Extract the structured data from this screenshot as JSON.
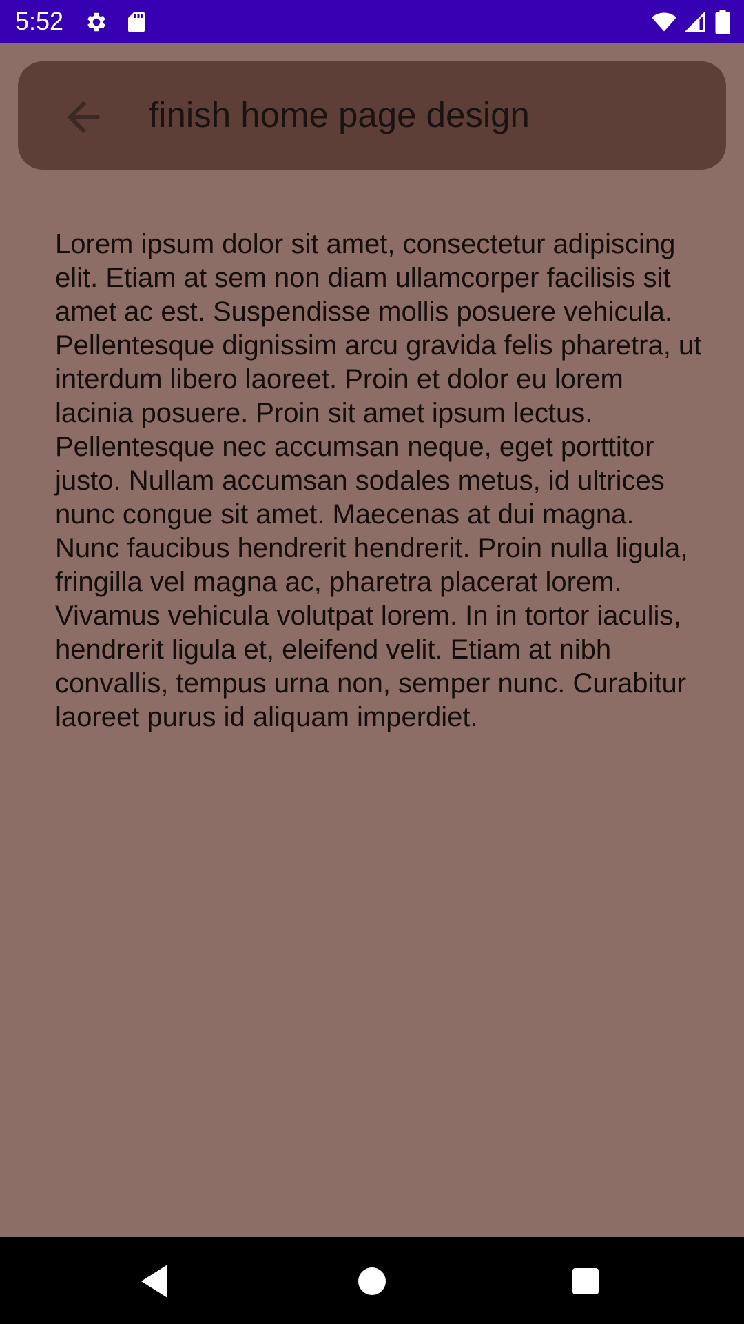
{
  "status_bar": {
    "time": "5:52",
    "icons": [
      "gear-icon",
      "sd-card-icon",
      "wifi-icon",
      "signal-icon",
      "battery-icon"
    ],
    "background": "#3700b3"
  },
  "app_bar": {
    "title": "finish home page design",
    "back_icon": "arrow-back-icon",
    "background": "#5d3f38"
  },
  "note": {
    "body": "Lorem ipsum dolor sit amet, consectetur adipiscing elit. Etiam at sem non diam ullamcorper facilisis sit amet ac est. Suspendisse mollis posuere vehicula. Pellentesque dignissim arcu gravida felis pharetra, ut interdum libero laoreet. Proin et dolor eu lorem lacinia posuere. Proin sit amet ipsum lectus. Pellentesque nec accumsan neque, eget porttitor justo. Nullam accumsan sodales metus, id ultrices nunc congue sit amet. Maecenas at dui magna. Nunc faucibus hendrerit hendrerit. Proin nulla ligula, fringilla vel magna ac, pharetra placerat lorem. Vivamus vehicula volutpat lorem. In in tortor iaculis, hendrerit ligula et, eleifend velit. Etiam at nibh convallis, tempus urna non, semper nunc. Curabitur laoreet purus id aliquam imperdiet."
  },
  "navigation_bar": {
    "buttons": [
      "back-triangle-icon",
      "home-circle-icon",
      "recents-square-icon"
    ]
  },
  "colors": {
    "page_background": "#8d6e66",
    "nav_bar": "#000000"
  }
}
